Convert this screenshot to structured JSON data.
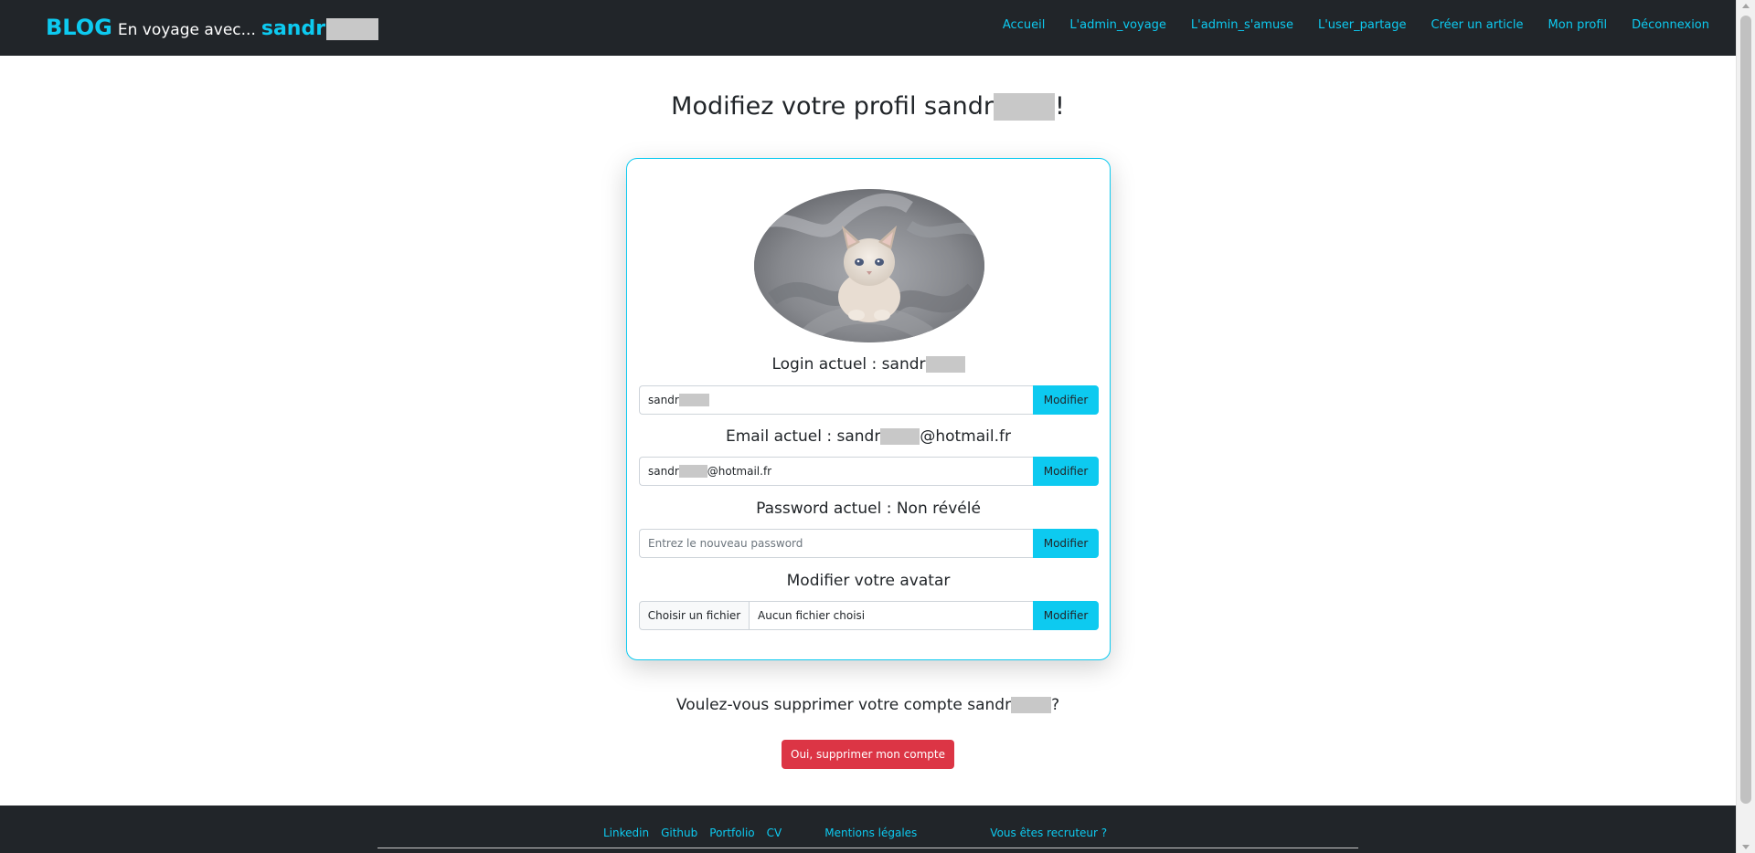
{
  "navbar": {
    "brand": "BLOG",
    "subtitle": "En voyage avec...",
    "user": "sandr",
    "links": [
      "Accueil",
      "L'admin_voyage",
      "L'admin_s'amuse",
      "L'user_partage",
      "Créer un article",
      "Mon profil",
      "Déconnexion"
    ]
  },
  "title": {
    "prefix": "Modifiez votre profil sandr",
    "suffix": "!"
  },
  "profile": {
    "avatar_alt": "kitten-photo",
    "login_label": "Login actuel : sandr",
    "login_value": "sandr",
    "email_label_prefix": "Email actuel : sandr",
    "email_label_suffix": "@hotmail.fr",
    "email_value_prefix": "sandr",
    "email_value_suffix": "@hotmail.fr",
    "password_label": "Password actuel : Non révélé",
    "password_placeholder": "Entrez le nouveau password",
    "avatar_label": "Modifier votre avatar",
    "file_button": "Choisir un fichier",
    "file_none": "Aucun fichier choisi",
    "modify_button": "Modifier"
  },
  "delete": {
    "question_prefix": "Voulez-vous supprimer votre compte sandr",
    "question_suffix": "?",
    "button": "Oui, supprimer mon compte"
  },
  "footer": {
    "links": [
      "Linkedin",
      "Github",
      "Portfolio",
      "CV",
      "Mentions légales",
      "Vous êtes recruteur ?"
    ]
  },
  "colors": {
    "accent": "#0dcaf0",
    "dark": "#212529",
    "danger": "#dc3545"
  }
}
